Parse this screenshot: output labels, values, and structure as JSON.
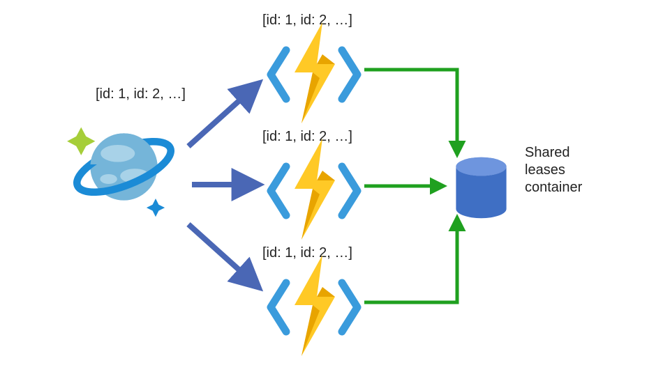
{
  "source": {
    "label": "[id: 1, id: 2, …]"
  },
  "functions": [
    {
      "label": "[id: 1, id: 2, …]"
    },
    {
      "label": "[id: 1, id: 2, …]"
    },
    {
      "label": "[id: 1, id: 2, …]"
    }
  ],
  "database": {
    "label_line1": "Shared",
    "label_line2": "leases",
    "label_line3": "container"
  },
  "colors": {
    "blue_arrow": "#4A67B5",
    "green_arrow": "#1FA01F",
    "function_bracket": "#3A9BDC",
    "lightning_main": "#FFC926",
    "lightning_shadow": "#E8A400",
    "planet_ring": "#1B8BD6",
    "planet_body": "#75B5D9",
    "planet_cloud": "#A8D2E8",
    "sparkle_green": "#A6CE39",
    "sparkle_blue": "#1B8BD6",
    "db": "#3F6FC4"
  }
}
